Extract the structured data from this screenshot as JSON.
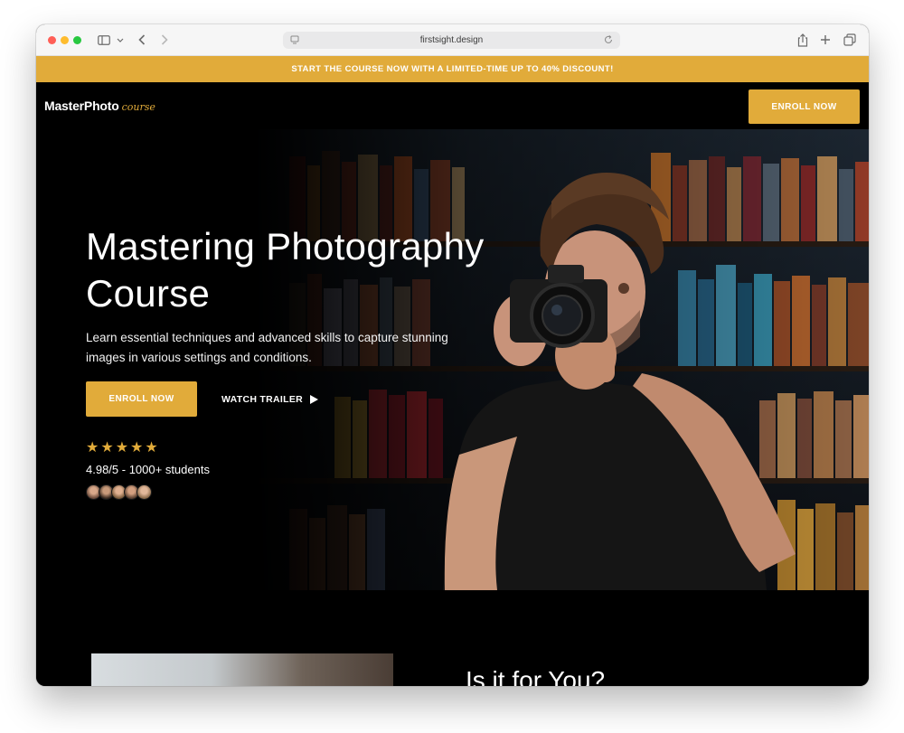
{
  "browser": {
    "url": "firstsight.design"
  },
  "promo": {
    "text": "START THE COURSE NOW WITH A LIMITED-TIME UP TO 40% DISCOUNT!"
  },
  "nav": {
    "logo_main": "MasterPhoto",
    "logo_script": "course",
    "enroll_label": "ENROLL NOW"
  },
  "hero": {
    "title_line1": "Mastering Photography",
    "title_line2": "Course",
    "subtitle": "Learn essential techniques and advanced skills to capture stunning images in various settings and conditions.",
    "enroll_label": "ENROLL NOW",
    "trailer_label": "WATCH TRAILER",
    "stars": 5,
    "rating_text": "4.98/5 - 1000+ students",
    "avatar_count": 5
  },
  "section": {
    "title": "Is it for You?"
  },
  "colors": {
    "accent": "#e1ab3a",
    "background": "#000000"
  }
}
